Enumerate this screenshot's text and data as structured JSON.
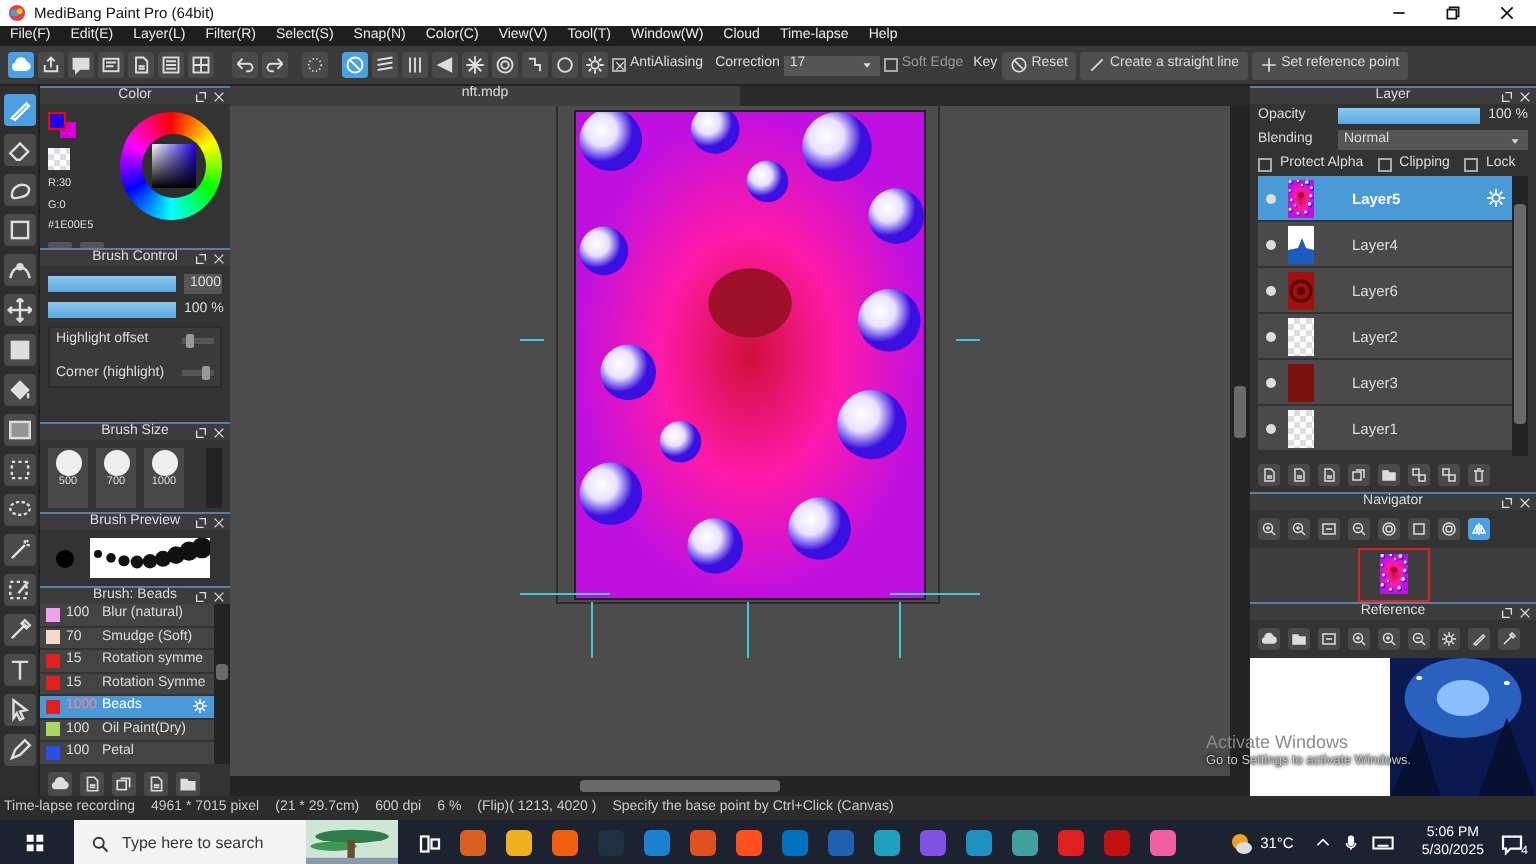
{
  "window": {
    "title": "MediBang Paint Pro (64bit)"
  },
  "menu": [
    "File(F)",
    "Edit(E)",
    "Layer(L)",
    "Filter(R)",
    "Select(S)",
    "Snap(N)",
    "Color(C)",
    "View(V)",
    "Tool(T)",
    "Window(W)",
    "Cloud",
    "Time-lapse",
    "Help"
  ],
  "snap_modes": [
    {
      "selected": true
    },
    {
      "selected": false
    },
    {
      "selected": false
    },
    {
      "selected": false
    },
    {
      "selected": false
    },
    {
      "selected": false
    },
    {
      "selected": false
    },
    {
      "selected": false
    },
    {
      "selected": false
    }
  ],
  "toolbar": {
    "antialiasing": {
      "label": "AntiAliasing",
      "checked": true
    },
    "correction": {
      "label": "Correction",
      "value": "17"
    },
    "soft_edge": {
      "label": "Soft Edge",
      "checked": false
    },
    "key_label": "Key",
    "buttons": [
      "Reset",
      "Create a straight line",
      "Set reference point"
    ]
  },
  "tools": [
    {
      "selected": true
    },
    {
      "selected": false
    },
    {
      "selected": false
    },
    {
      "selected": false
    },
    {
      "selected": false
    },
    {
      "selected": false
    },
    {
      "selected": false
    },
    {
      "selected": false
    },
    {
      "selected": false
    },
    {
      "selected": false
    },
    {
      "selected": false
    },
    {
      "selected": false
    },
    {
      "selected": false
    },
    {
      "selected": false
    },
    {
      "selected": false
    },
    {
      "selected": false
    },
    {
      "selected": false
    }
  ],
  "color_panel": {
    "title": "Color",
    "readouts": [
      "R:30",
      "G:0",
      "#1E00E5"
    ]
  },
  "brush_control": {
    "title": "Brush Control",
    "size": {
      "level": 1,
      "reading": "1000"
    },
    "opacity": {
      "level": 1,
      "reading": "100 %"
    },
    "options": [
      {
        "label": "Highlight offset",
        "level": 0.15
      },
      {
        "label": "Corner (highlight)",
        "level": 0.8
      }
    ]
  },
  "brush_size": {
    "title": "Brush Size",
    "sizes": [
      "500",
      "700",
      "1000"
    ]
  },
  "brush_preview": {
    "title": "Brush Preview"
  },
  "brush_list": {
    "title": "Brush: Beads",
    "items": [
      {
        "color": "#f0a0ee",
        "size": "100",
        "name": "Blur (natural)",
        "selected": false
      },
      {
        "color": "#f8d8c8",
        "size": "70",
        "name": "Smudge (Soft)",
        "selected": false
      },
      {
        "color": "#e02020",
        "size": "15",
        "name": "Rotation symme",
        "selected": false
      },
      {
        "color": "#e02020",
        "size": "15",
        "name": "Rotation Symme",
        "selected": false
      },
      {
        "color": "#e02020",
        "size": "1000",
        "name": "Beads",
        "selected": true
      },
      {
        "color": "#a8d860",
        "size": "100",
        "name": "Oil Paint(Dry)",
        "selected": false
      },
      {
        "color": "#2a4ee8",
        "size": "100",
        "name": "Petal",
        "selected": false
      }
    ]
  },
  "document_tab": "nft.mdp",
  "layer_panel": {
    "title": "Layer",
    "opacity": {
      "label": "Opacity",
      "level": 1,
      "reading": "100 %"
    },
    "blending": {
      "label": "Blending",
      "value": "Normal"
    },
    "options": [
      {
        "label": "Protect Alpha",
        "checked": false
      },
      {
        "label": "Clipping",
        "checked": false
      },
      {
        "label": "Lock",
        "checked": false
      }
    ],
    "layers": [
      {
        "name": "Layer5",
        "kind": "picture",
        "visible": true,
        "selected": true
      },
      {
        "name": "Layer4",
        "kind": "shape",
        "visible": true,
        "selected": false
      },
      {
        "name": "Layer6",
        "kind": "rings",
        "visible": true,
        "selected": false
      },
      {
        "name": "Layer2",
        "kind": "empty",
        "visible": true,
        "selected": false
      },
      {
        "name": "Layer3",
        "kind": "fill",
        "visible": true,
        "selected": false
      },
      {
        "name": "Layer1",
        "kind": "empty",
        "visible": true,
        "selected": false
      }
    ]
  },
  "navigator": {
    "title": "Navigator",
    "flip_lock_on": true
  },
  "reference": {
    "title": "Reference"
  },
  "status_bar": [
    "Time-lapse recording",
    "4961 * 7015 pixel",
    "(21 * 29.7cm)",
    "600 dpi",
    "6 %",
    "(Flip)( 1213, 4020 )",
    "Specify the base point by Ctrl+Click (Canvas)"
  ],
  "activation_notice": [
    "Activate Windows",
    "Go to Settings to activate Windows."
  ],
  "taskbar": {
    "search_placeholder": "Type here to search",
    "weather": "31°C",
    "time": "5:06 PM",
    "date": "5/30/2025",
    "notifications": "4"
  }
}
